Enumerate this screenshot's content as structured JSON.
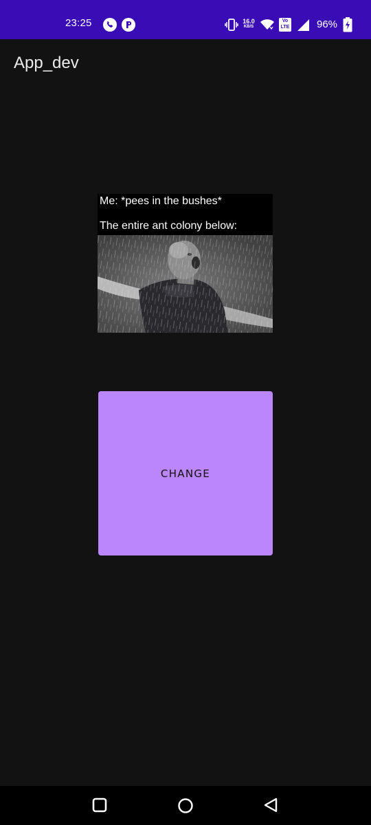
{
  "status_bar": {
    "time": "23:25",
    "speed_value": "16.0",
    "speed_unit": "KB/S",
    "volte_top": "Vo",
    "volte_bottom": "LTE",
    "battery": "96%",
    "background_color": "#3a0cb5",
    "icons": [
      "phone-call-icon",
      "app-notification-icon",
      "vibrate-icon",
      "wifi-icon",
      "volte-icon",
      "signal-icon",
      "battery-charging-icon"
    ]
  },
  "app_bar": {
    "title": "App_dev"
  },
  "meme": {
    "caption_line1": "Me: *pees in the bushes*",
    "caption_line2": "The entire ant colony below:"
  },
  "button": {
    "label": "CHANGE",
    "color": "#bb86fc"
  },
  "nav_bar": {
    "icons": [
      "recents-icon",
      "home-icon",
      "back-icon"
    ]
  },
  "colors": {
    "background": "#121212",
    "status_bar": "#3a0cb5",
    "accent": "#bb86fc"
  }
}
